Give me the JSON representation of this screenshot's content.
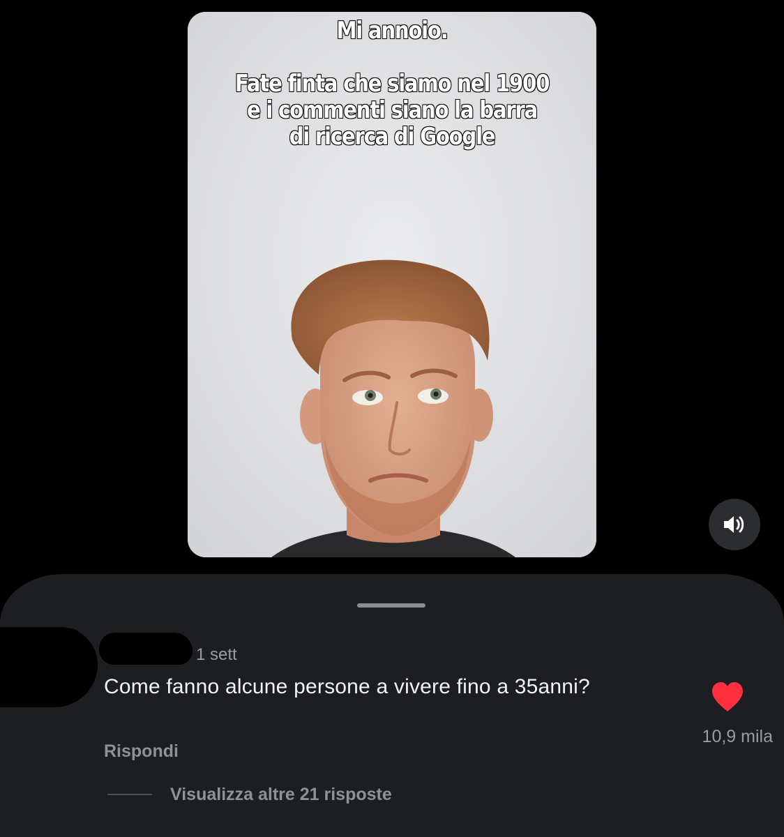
{
  "video": {
    "caption": "Mi annoio.\n\nFate finta che siamo nel 1900\ne i commenti siano la barra\ndi ricerca di Google"
  },
  "controls": {
    "sound_icon": "speaker-volume-icon"
  },
  "comment": {
    "time": "1 sett",
    "text": "Come fanno alcune persone a vivere fino a 35anni?",
    "reply_label": "Rispondi",
    "like_icon": "heart-filled-icon",
    "like_color": "#ff3040",
    "like_count": "10,9 mila",
    "view_replies_label": "Visualizza altre 21 risposte"
  },
  "colors": {
    "background": "#000000",
    "sheet": "#1c1e22",
    "secondary_text": "#9a9ca2",
    "primary_text": "#f2f3f5"
  }
}
